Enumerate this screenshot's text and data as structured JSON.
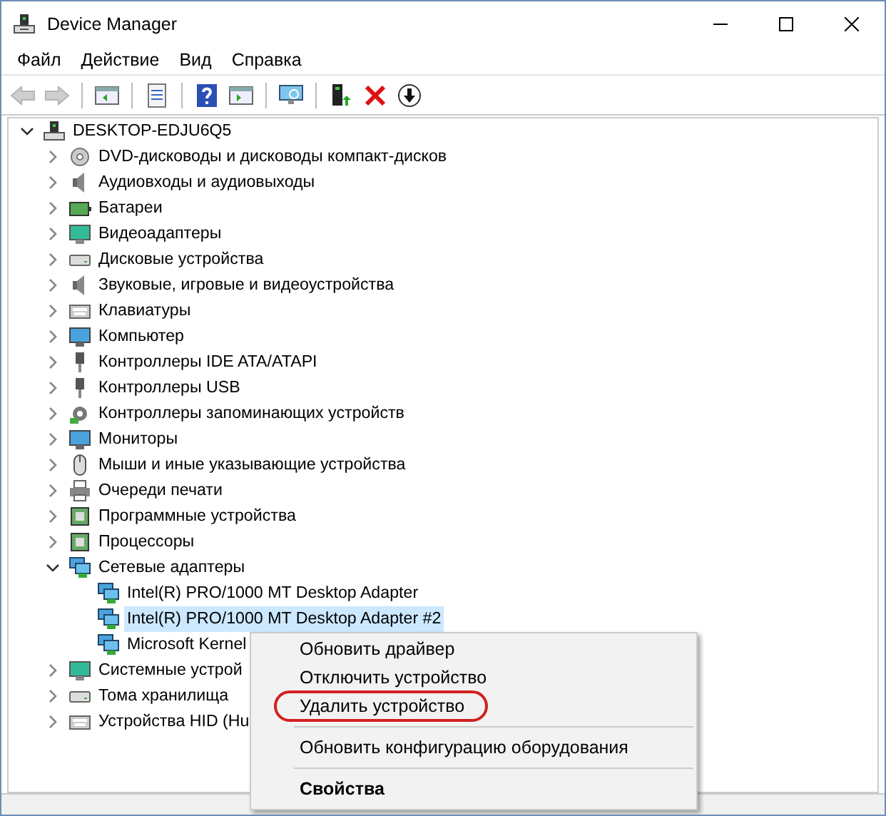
{
  "window": {
    "title": "Device Manager"
  },
  "menu_bar": [
    "Файл",
    "Действие",
    "Вид",
    "Справка"
  ],
  "toolbar": [
    {
      "kind": "back",
      "disabled": true
    },
    {
      "kind": "forward",
      "disabled": true
    },
    {
      "kind": "separator"
    },
    {
      "kind": "panel",
      "disabled": false
    },
    {
      "kind": "separator"
    },
    {
      "kind": "properties",
      "disabled": false
    },
    {
      "kind": "separator"
    },
    {
      "kind": "help",
      "disabled": false
    },
    {
      "kind": "panel2",
      "disabled": false
    },
    {
      "kind": "separator"
    },
    {
      "kind": "scan",
      "disabled": false
    },
    {
      "kind": "separator"
    },
    {
      "kind": "add",
      "disabled": false
    },
    {
      "kind": "remove",
      "disabled": false
    },
    {
      "kind": "download",
      "disabled": false
    }
  ],
  "tree": {
    "label": "DESKTOP-EDJU6Q5",
    "kind": "computer",
    "expanded": true,
    "selected": false,
    "children": [
      {
        "label": "DVD-дисководы и дисководы компакт-дисков",
        "kind": "disc",
        "expanded": false,
        "selected": false
      },
      {
        "label": "Аудиовходы и аудиовыходы",
        "kind": "speaker",
        "expanded": false,
        "selected": false
      },
      {
        "label": "Батареи",
        "kind": "battery",
        "expanded": false,
        "selected": false
      },
      {
        "label": "Видеоадаптеры",
        "kind": "display",
        "expanded": false,
        "selected": false
      },
      {
        "label": "Дисковые устройства",
        "kind": "drive",
        "expanded": false,
        "selected": false
      },
      {
        "label": "Звуковые, игровые и видеоустройства",
        "kind": "speaker",
        "expanded": false,
        "selected": false
      },
      {
        "label": "Клавиатуры",
        "kind": "keyboard",
        "expanded": false,
        "selected": false
      },
      {
        "label": "Компьютер",
        "kind": "monitor",
        "expanded": false,
        "selected": false
      },
      {
        "label": "Контроллеры IDE ATA/ATAPI",
        "kind": "plug",
        "expanded": false,
        "selected": false
      },
      {
        "label": "Контроллеры USB",
        "kind": "plug",
        "expanded": false,
        "selected": false
      },
      {
        "label": "Контроллеры запоминающих устройств",
        "kind": "gear",
        "expanded": false,
        "selected": false
      },
      {
        "label": "Мониторы",
        "kind": "monitor",
        "expanded": false,
        "selected": false
      },
      {
        "label": "Мыши и иные указывающие устройства",
        "kind": "mouse",
        "expanded": false,
        "selected": false
      },
      {
        "label": "Очереди печати",
        "kind": "printer",
        "expanded": false,
        "selected": false
      },
      {
        "label": "Программные устройства",
        "kind": "chip",
        "expanded": false,
        "selected": false
      },
      {
        "label": "Процессоры",
        "kind": "chip",
        "expanded": false,
        "selected": false
      },
      {
        "label": "Сетевые адаптеры",
        "kind": "network",
        "expanded": true,
        "selected": false,
        "children": [
          {
            "label": "Intel(R) PRO/1000 MT Desktop Adapter",
            "kind": "network",
            "selected": false
          },
          {
            "label": "Intel(R) PRO/1000 MT Desktop Adapter #2",
            "kind": "network",
            "selected": true
          },
          {
            "label": "Microsoft Kernel",
            "kind": "network",
            "selected": false
          }
        ]
      },
      {
        "label": "Системные устрой",
        "kind": "display",
        "expanded": false,
        "selected": false
      },
      {
        "label": "Тома хранилища",
        "kind": "drive",
        "expanded": false,
        "selected": false
      },
      {
        "label": "Устройства HID (Hu",
        "kind": "keyboard",
        "expanded": false,
        "selected": false
      }
    ]
  },
  "context_menu": [
    {
      "label": "Обновить драйвер",
      "kind": "item",
      "circled": false
    },
    {
      "label": "Отключить устройство",
      "kind": "item",
      "circled": false
    },
    {
      "label": "Удалить устройство",
      "kind": "item",
      "circled": true
    },
    {
      "kind": "separator"
    },
    {
      "label": "Обновить конфигурацию оборудования",
      "kind": "item",
      "circled": false
    },
    {
      "kind": "separator"
    },
    {
      "label": "Свойства",
      "kind": "default",
      "circled": false
    }
  ]
}
